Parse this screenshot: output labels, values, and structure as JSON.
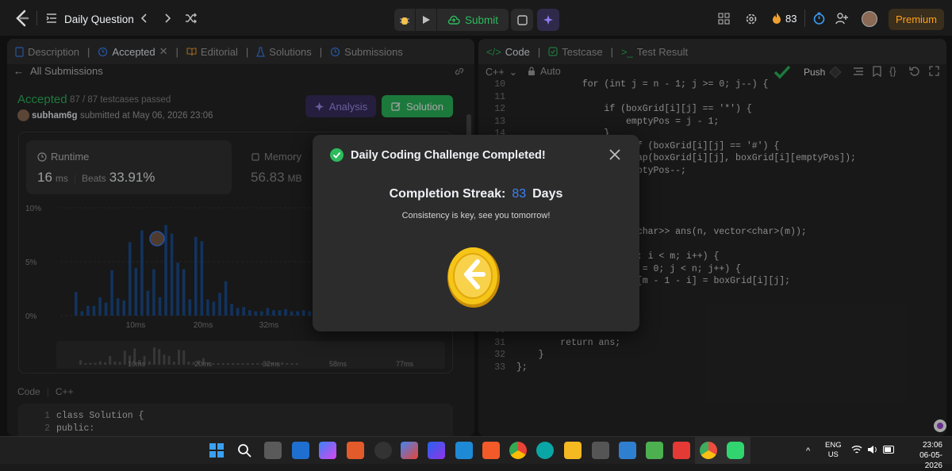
{
  "topbar": {
    "title": "Daily Question",
    "submit_label": "Submit",
    "streak_count": "83",
    "premium_label": "Premium"
  },
  "left_panel": {
    "tabs": [
      {
        "label": "Description"
      },
      {
        "label": "Accepted"
      },
      {
        "label": "Editorial"
      },
      {
        "label": "Solutions"
      },
      {
        "label": "Submissions"
      }
    ],
    "back_label": "All Submissions",
    "status": "Accepted",
    "testcases": "87 / 87 testcases passed",
    "username": "subham6g",
    "submitted_at": "submitted at May 06, 2026 23:06",
    "analysis_label": "Analysis",
    "solution_label": "Solution",
    "runtime": {
      "label": "Runtime",
      "value": "16",
      "unit": "ms",
      "beats_label": "Beats",
      "beats_value": "33.91%"
    },
    "memory": {
      "label": "Memory",
      "value": "56.83",
      "unit": "MB"
    },
    "code_lang_label": "Code",
    "code_lang": "C++",
    "code_lines": [
      {
        "n": "1",
        "text": "class Solution {"
      },
      {
        "n": "2",
        "text": "public:"
      }
    ]
  },
  "chart_data": {
    "type": "bar",
    "y_tick_labels": [
      "10%",
      "5%",
      "0%"
    ],
    "x_tick_labels": [
      "10ms",
      "20ms",
      "32ms"
    ],
    "mini_x_tick_labels": [
      "10ms",
      "20ms",
      "32ms",
      "58ms",
      "77ms"
    ],
    "ylim": [
      0,
      10
    ],
    "values": [
      2.2,
      0.4,
      0.9,
      0.9,
      1.7,
      1.2,
      4.2,
      1.6,
      1.4,
      6.8,
      4.4,
      7.9,
      2.3,
      4.3,
      1.7,
      8.4,
      7.6,
      4.9,
      4.3,
      1.5,
      7.3,
      6.9,
      1.5,
      1.3,
      2.1,
      3.2,
      1.1,
      0.7,
      0.8,
      0.5,
      0.4,
      0.4,
      0.7,
      0.5,
      0.5,
      0.6,
      0.4,
      0.4,
      0.5,
      0.4,
      0.3,
      1.1,
      0.4,
      0.4,
      0.5
    ]
  },
  "right_panel": {
    "tabs": [
      {
        "label": "Code"
      },
      {
        "label": "Testcase"
      },
      {
        "label": "Test Result"
      }
    ],
    "lang": "C++",
    "auto_label": "Auto",
    "push_label": "Push",
    "code_lines": [
      {
        "n": "10",
        "text": "            for (int j = n - 1; j >= 0; j--) {"
      },
      {
        "n": "11",
        "text": ""
      },
      {
        "n": "12",
        "text": "                if (boxGrid[i][j] == '*') {"
      },
      {
        "n": "13",
        "text": "                    emptyPos = j - 1;"
      },
      {
        "n": "14",
        "text": "                }"
      },
      {
        "n": "15",
        "text": "                else if (boxGrid[i][j] == '#') {"
      },
      {
        "n": "16",
        "text": "                    swap(boxGrid[i][j], boxGrid[i][emptyPos]);"
      },
      {
        "n": "17",
        "text": "                    emptyPos--;"
      },
      {
        "n": "18",
        "text": "                }"
      },
      {
        "n": "19",
        "text": "            }"
      },
      {
        "n": "20",
        "text": "        }"
      },
      {
        "n": "21",
        "text": ""
      },
      {
        "n": "22",
        "text": "        vector<vector<char>> ans(n, vector<char>(m));"
      },
      {
        "n": "23",
        "text": ""
      },
      {
        "n": "24",
        "text": "        for (int i = 0; i < m; i++) {"
      },
      {
        "n": "25",
        "text": "            for (int j = 0; j < n; j++) {"
      },
      {
        "n": "26",
        "text": "                ans[j][m - 1 - i] = boxGrid[i][j];"
      },
      {
        "n": "27",
        "text": "            }"
      },
      {
        "n": "28",
        "text": "        }"
      },
      {
        "n": "29",
        "text": ""
      },
      {
        "n": "30",
        "text": ""
      },
      {
        "n": "31",
        "text": "        return ans;"
      },
      {
        "n": "32",
        "text": "    }"
      },
      {
        "n": "33",
        "text": "};"
      }
    ]
  },
  "modal": {
    "title": "Daily Coding Challenge Completed!",
    "streak_label": "Completion Streak:",
    "streak_value": "83",
    "streak_unit": "Days",
    "message": "Consistency is key, see you tomorrow!"
  },
  "taskbar": {
    "lang_line1": "ENG",
    "lang_line2": "US",
    "time": "23:06",
    "date": "06-05-2026"
  },
  "colors": {
    "accent_green": "#2cbb5d",
    "accent_orange": "#ffa116",
    "bar_blue": "#1d4f91",
    "streak_blue": "#3b82f6"
  }
}
